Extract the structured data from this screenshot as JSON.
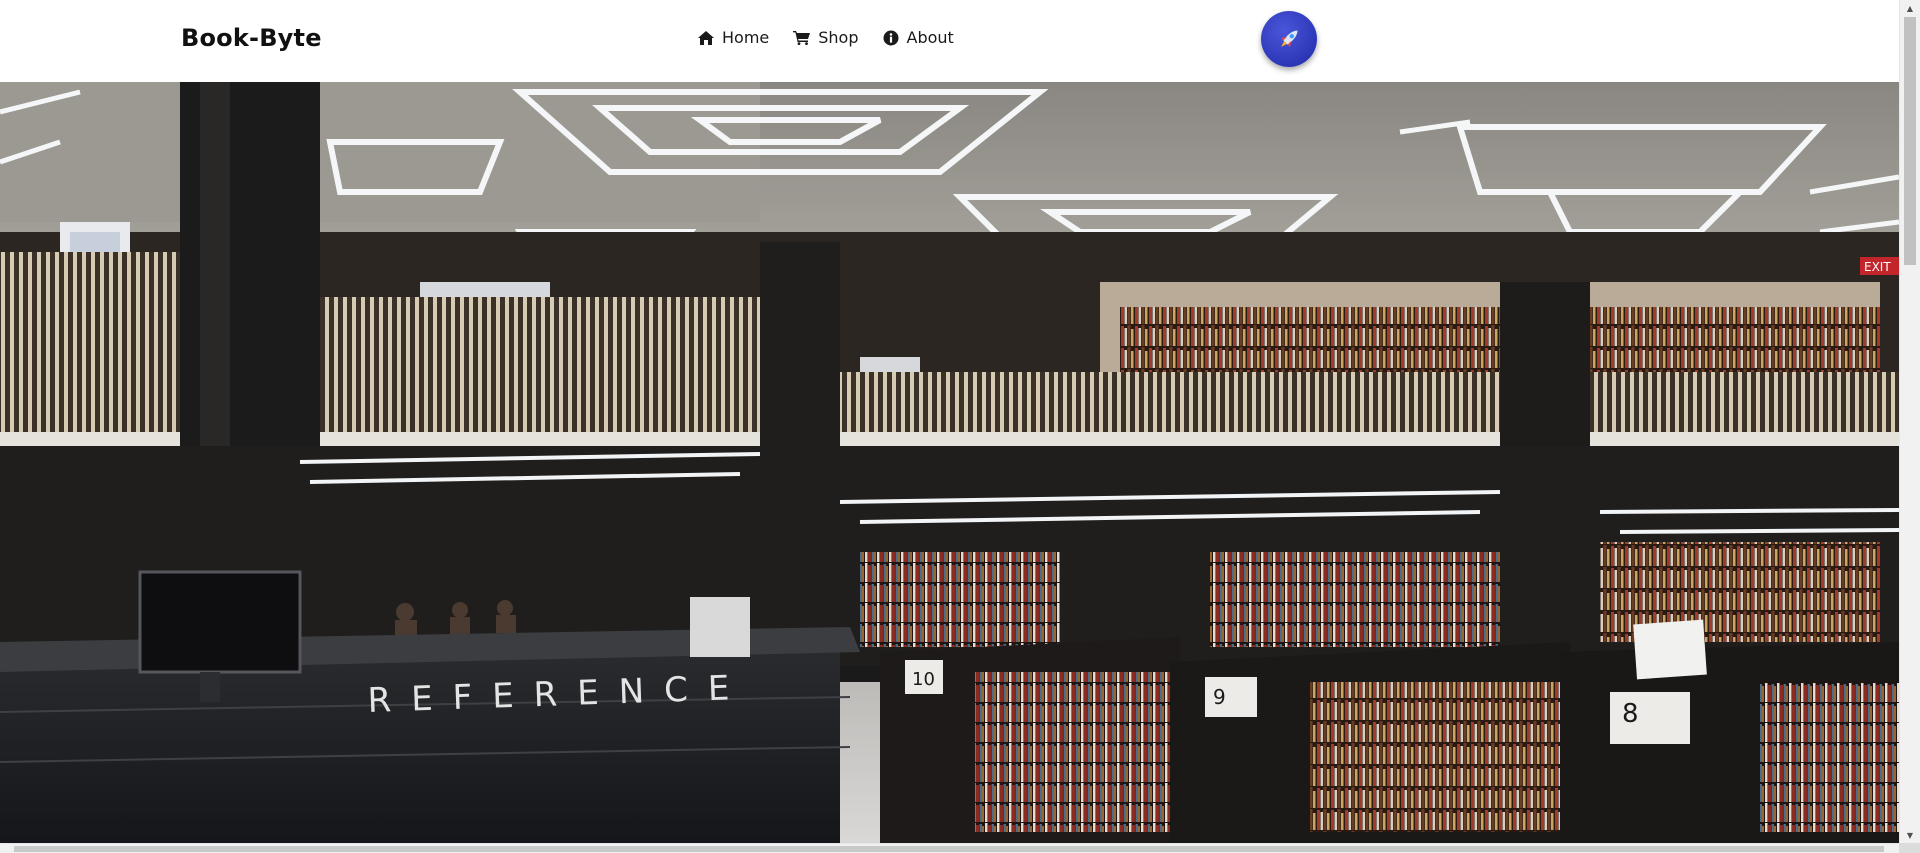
{
  "header": {
    "brand": "Book-Byte",
    "nav": [
      {
        "label": "Home",
        "icon": "home-icon"
      },
      {
        "label": "Shop",
        "icon": "shopping-cart-icon"
      },
      {
        "label": "About",
        "icon": "info-circle-icon"
      }
    ],
    "action_button_icon": "rocket-icon",
    "action_button_color": "#2f3bbf"
  },
  "hero": {
    "image": "library-reference-desk-photo",
    "desk_sign": "REFERENCE",
    "shelf_numbers": [
      "10",
      "9",
      "8"
    ],
    "exit_sign": "EXIT"
  }
}
